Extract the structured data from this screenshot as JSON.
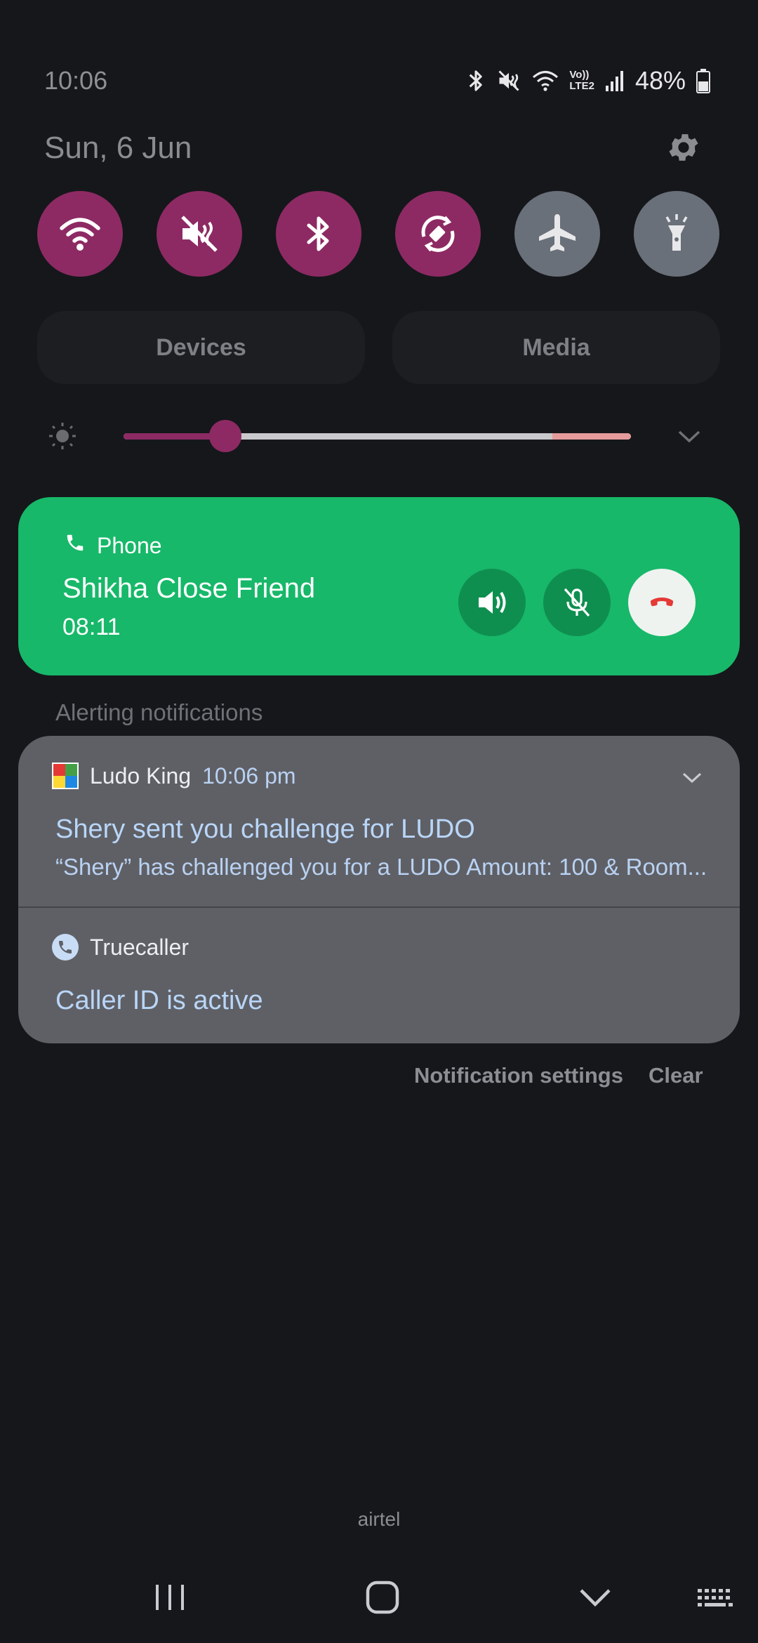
{
  "status_bar": {
    "time": "10:06",
    "battery_percent": "48%",
    "volte_top": "Vo))",
    "volte_bottom": "LTE2"
  },
  "date": "Sun, 6 Jun",
  "quick_toggles": [
    {
      "name": "wifi",
      "icon": "wifi-icon",
      "state": "on"
    },
    {
      "name": "sound",
      "icon": "sound-mute-icon",
      "state": "on"
    },
    {
      "name": "bluetooth",
      "icon": "bluetooth-icon",
      "state": "on"
    },
    {
      "name": "auto-rotate",
      "icon": "auto-rotate-icon",
      "state": "on"
    },
    {
      "name": "airplane-mode",
      "icon": "airplane-icon",
      "state": "off"
    },
    {
      "name": "flashlight",
      "icon": "flashlight-icon",
      "state": "off"
    }
  ],
  "panel_buttons": {
    "devices": "Devices",
    "media": "Media"
  },
  "brightness": {
    "level": 0.2
  },
  "call": {
    "app": "Phone",
    "contact": "Shikha Close Friend",
    "duration": "08:11"
  },
  "section_label": "Alerting notifications",
  "notifications": [
    {
      "app": "Ludo King",
      "time": "10:06 pm",
      "title": "Shery sent you challenge for LUDO",
      "text": "“Shery” has challenged you for a LUDO Amount: 100 & Room..."
    },
    {
      "app": "Truecaller",
      "title": "Caller ID is active"
    }
  ],
  "footer": {
    "settings": "Notification settings",
    "clear": "Clear"
  },
  "carrier": "airtel",
  "colors": {
    "toggle_on": "#8d2a63",
    "toggle_off": "#697079",
    "call_card": "#17b869",
    "notification_card": "#5f6066",
    "end_call": "#e53935"
  }
}
